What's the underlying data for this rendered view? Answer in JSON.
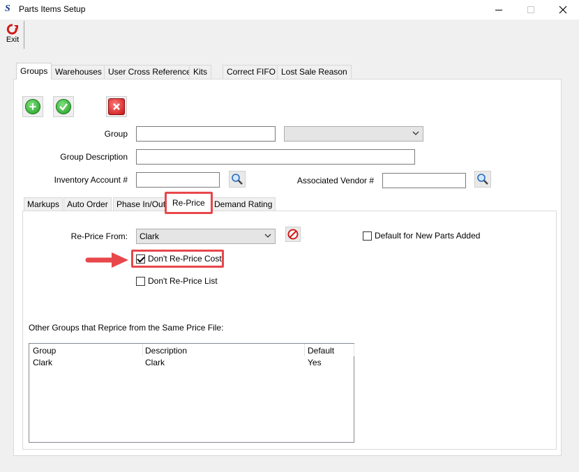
{
  "window": {
    "title": "Parts Items Setup",
    "app_icon": "S"
  },
  "toolbar": {
    "exit_label": "Exit"
  },
  "tabs": [
    {
      "label": "Groups",
      "active": true
    },
    {
      "label": "Warehouses"
    },
    {
      "label": "User Cross Reference"
    },
    {
      "label": "Kits"
    },
    {
      "label": "Correct FIFO"
    },
    {
      "label": "Lost Sale Reason"
    }
  ],
  "actions": {
    "add_icon": "plus-circle-icon",
    "save_icon": "check-circle-icon",
    "delete_icon": "red-x-icon"
  },
  "form": {
    "group_label": "Group",
    "group_value": "",
    "group_combo_value": "",
    "group_description_label": "Group Description",
    "group_description_value": "",
    "inventory_account_label": "Inventory Account #",
    "inventory_account_value": "",
    "associated_vendor_label": "Associated Vendor #",
    "associated_vendor_value": ""
  },
  "inner_tabs": [
    {
      "label": "Markups"
    },
    {
      "label": "Auto Order"
    },
    {
      "label": "Phase In/Out"
    },
    {
      "label": "Re-Price",
      "active": true
    },
    {
      "label": "Demand Rating"
    }
  ],
  "reprice": {
    "from_label": "Re-Price From:",
    "from_value": "Clark",
    "default_new_parts_label": "Default for New Parts Added",
    "default_new_parts_checked": false,
    "dont_reprice_cost_label": "Don't Re-Price Cost",
    "dont_reprice_cost_checked": true,
    "dont_reprice_list_label": "Don't Re-Price List",
    "dont_reprice_list_checked": false,
    "other_groups_label": "Other Groups that Reprice from the Same Price File:"
  },
  "list": {
    "columns": [
      "Group",
      "Description",
      "Default"
    ],
    "rows": [
      [
        "Clark",
        "Clark",
        "Yes"
      ]
    ]
  },
  "colors": {
    "highlight": "#e8474b",
    "annotation_arrow": "#e8474b"
  }
}
